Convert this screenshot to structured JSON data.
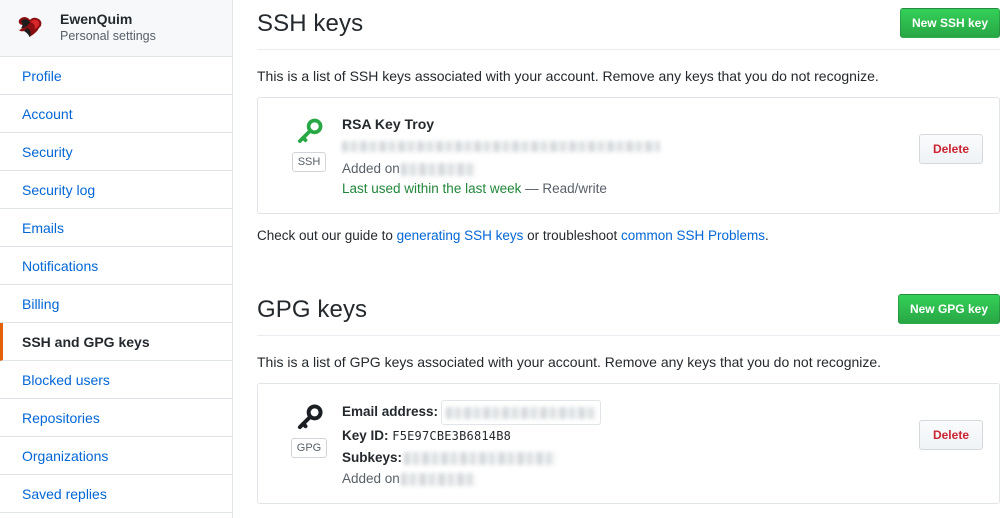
{
  "sidebar": {
    "profile": {
      "avatar_icon": "bird-avatar",
      "username": "EwenQuim",
      "subtitle": "Personal settings"
    },
    "items": [
      {
        "label": "Profile",
        "active": false
      },
      {
        "label": "Account",
        "active": false
      },
      {
        "label": "Security",
        "active": false
      },
      {
        "label": "Security log",
        "active": false
      },
      {
        "label": "Emails",
        "active": false
      },
      {
        "label": "Notifications",
        "active": false
      },
      {
        "label": "Billing",
        "active": false
      },
      {
        "label": "SSH and GPG keys",
        "active": true
      },
      {
        "label": "Blocked users",
        "active": false
      },
      {
        "label": "Repositories",
        "active": false
      },
      {
        "label": "Organizations",
        "active": false
      },
      {
        "label": "Saved replies",
        "active": false
      }
    ],
    "active_indicator_color": "#e36209"
  },
  "ssh_section": {
    "title": "SSH keys",
    "new_button_label": "New SSH key",
    "description": "This is a list of SSH keys associated with your account. Remove any keys that you do not recognize.",
    "key": {
      "icon": "key-icon-green",
      "badge": "SSH",
      "title": "RSA Key Troy",
      "fingerprint": "",
      "added_label": "Added on",
      "added_value": "",
      "last_used": "Last used within the last week",
      "separator": "—",
      "access": "Read/write",
      "delete_label": "Delete"
    },
    "guide": {
      "prefix": "Check out our guide to ",
      "link1": "generating SSH keys",
      "middle": " or troubleshoot ",
      "link2": "common SSH Problems",
      "suffix": "."
    }
  },
  "gpg_section": {
    "title": "GPG keys",
    "new_button_label": "New GPG key",
    "description": "This is a list of GPG keys associated with your account. Remove any keys that you do not recognize.",
    "key": {
      "icon": "key-icon-black",
      "badge": "GPG",
      "email_label": "Email address:",
      "email_value": "",
      "keyid_label": "Key ID:",
      "keyid_value": "F5E97CBE3B6814B8",
      "subkeys_label": "Subkeys:",
      "subkeys_value": "",
      "added_label": "Added on",
      "added_value": "",
      "delete_label": "Delete"
    }
  },
  "colors": {
    "green_button": "#28a745",
    "link_blue": "#0366d6",
    "delete_red": "#cb2431",
    "active_orange": "#e36209",
    "ssh_key_green": "#28a745",
    "last_used_green": "#22863a"
  }
}
